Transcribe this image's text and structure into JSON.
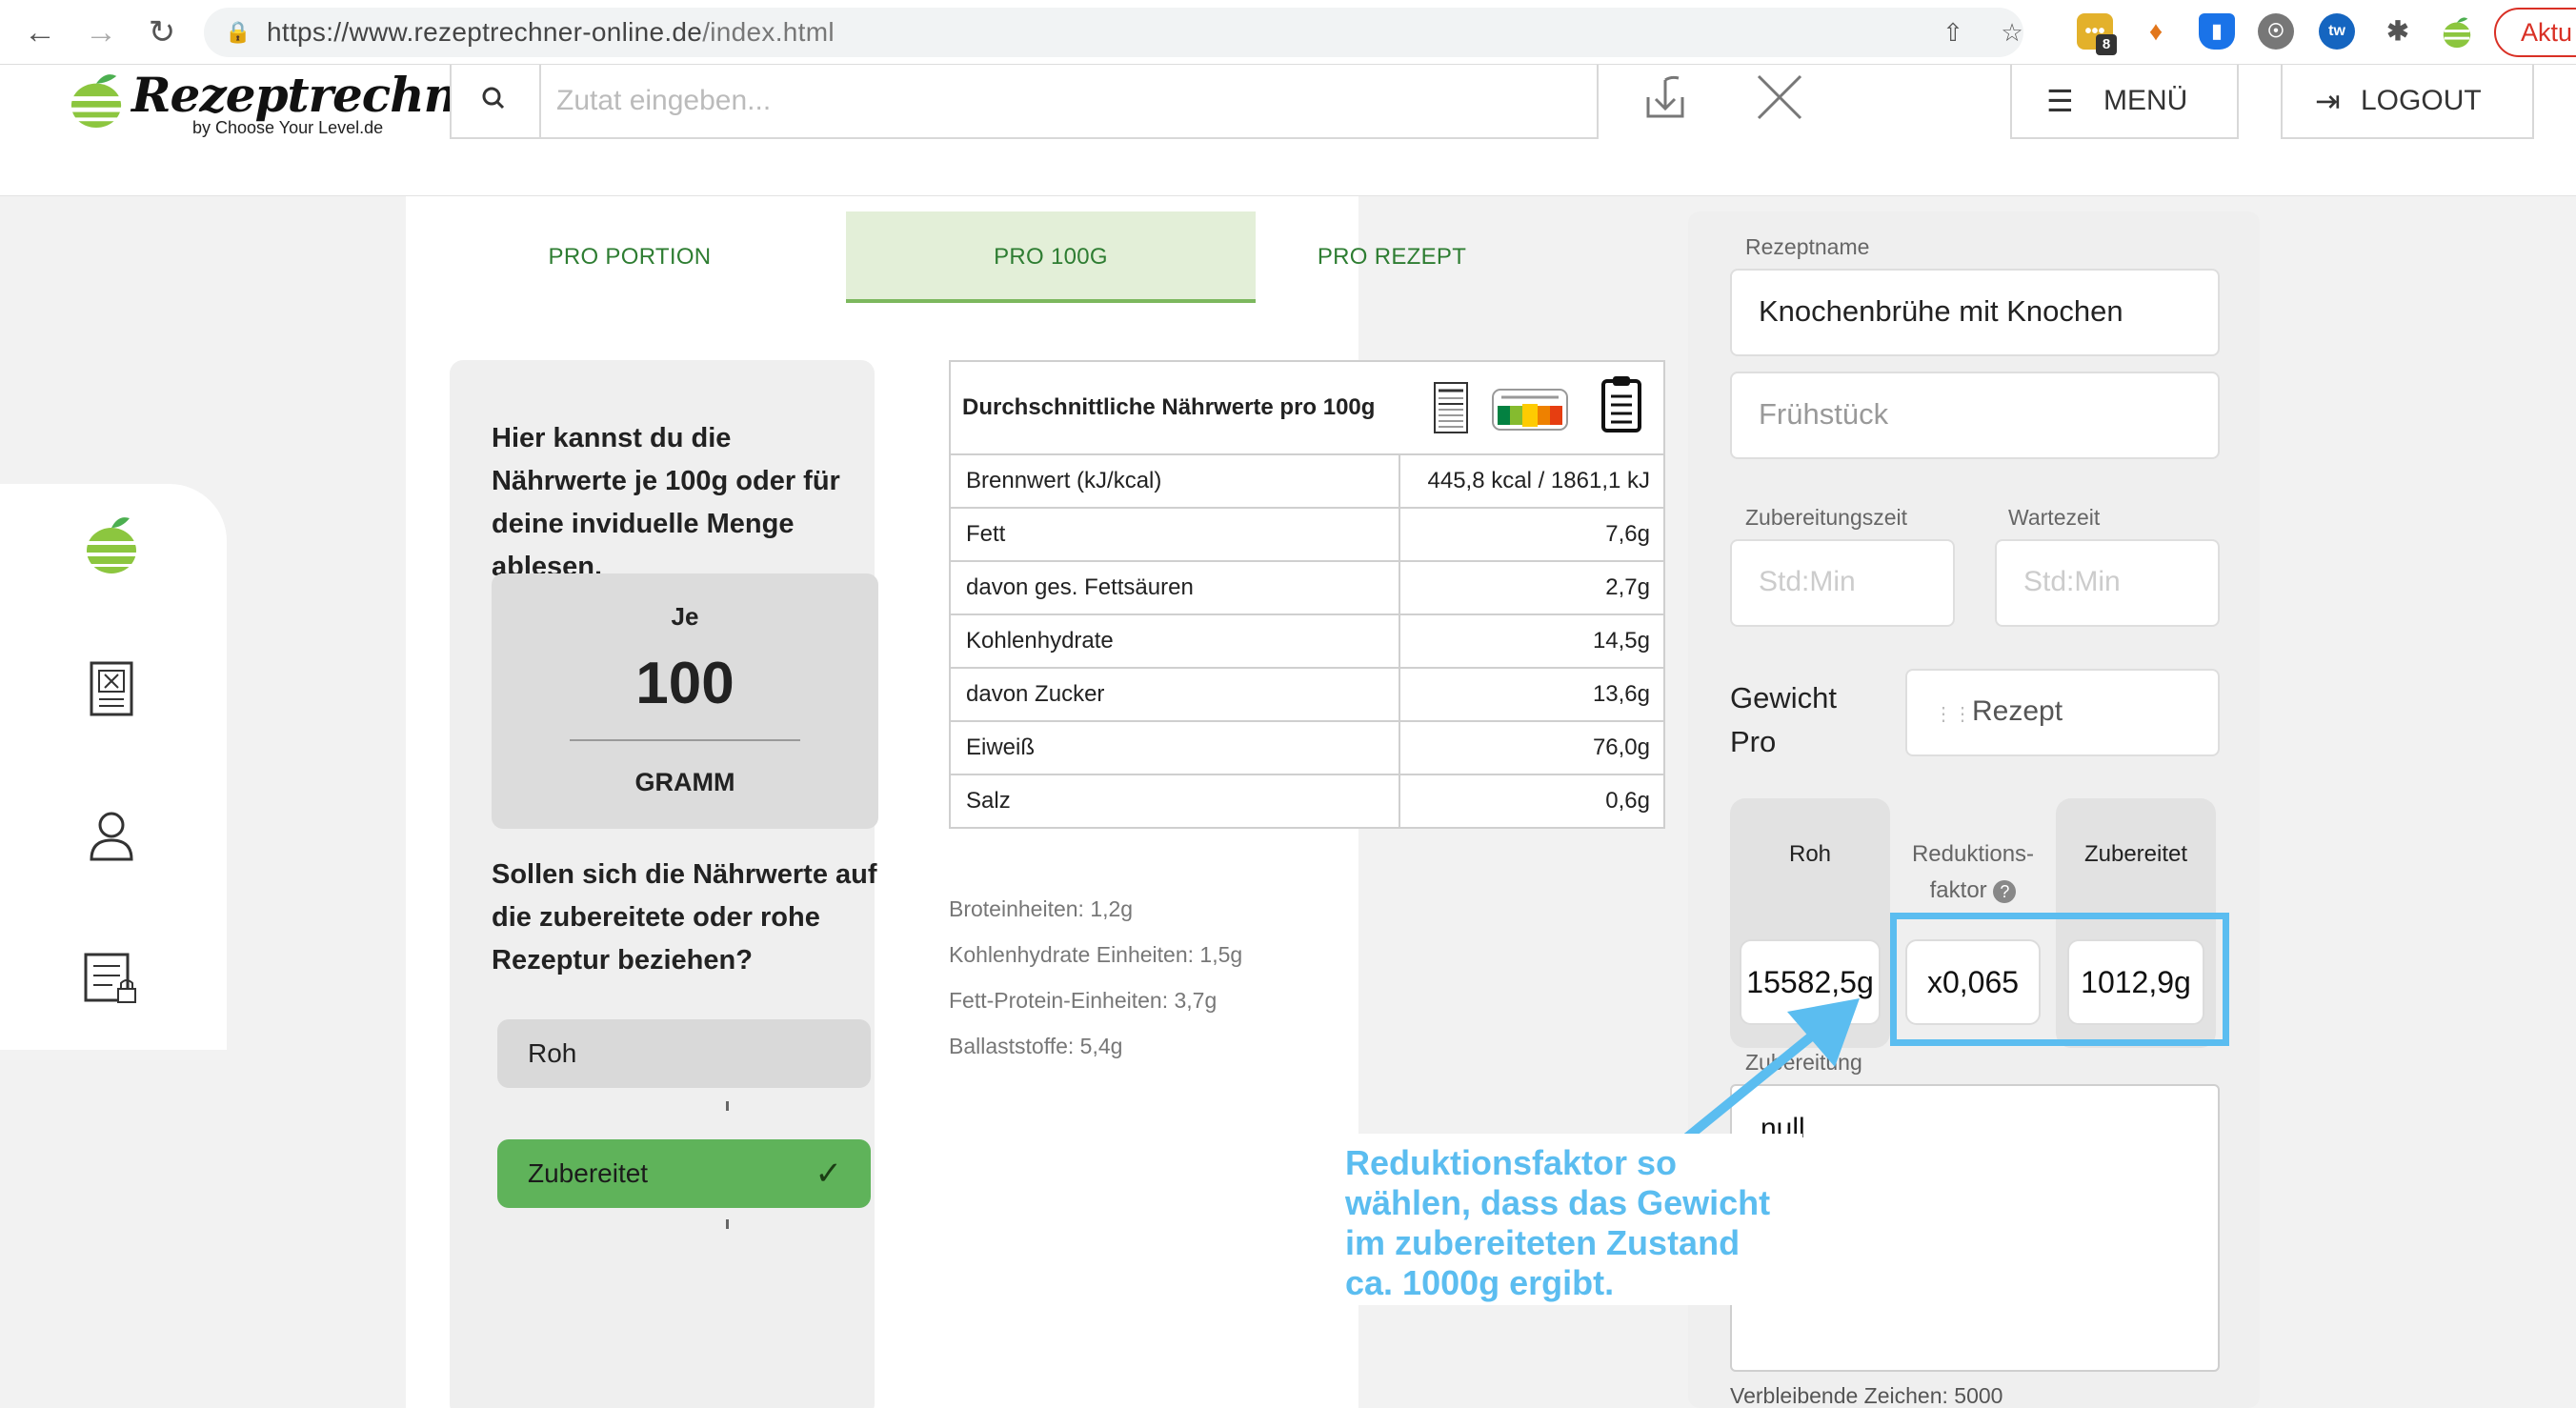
{
  "browser": {
    "url_prefix": "https://www.rezeptrechner-online.de",
    "url_path": "/index.html",
    "update_label": "Aktu",
    "extension_badge": "8"
  },
  "header": {
    "logo_text": "Rezeptrechner",
    "logo_sub": "by Choose Your Level.de",
    "search_placeholder": "Zutat eingeben...",
    "menu_label": "MENÜ",
    "logout_label": "LOGOUT"
  },
  "tabs": [
    {
      "label": "PRO PORTION",
      "active": false
    },
    {
      "label": "PRO 100G",
      "active": true
    },
    {
      "label": "PRO REZEPT",
      "active": false
    }
  ],
  "info": {
    "intro": "Hier kannst du die Nährwerte je 100g oder für deine inviduelle Menge ablesen.",
    "per_label": "Je",
    "amount": "100",
    "unit": "GRAMM",
    "question": "Sollen sich die Nährwerte auf die zubereitete oder rohe Rezeptur beziehen?",
    "option_raw": "Roh",
    "option_cooked": "Zubereitet"
  },
  "nutrition": {
    "title": "Durchschnittliche Nährwerte pro 100g",
    "rows": [
      {
        "label": "Brennwert (kJ/kcal)",
        "value": "445,8 kcal / 1861,1 kJ"
      },
      {
        "label": "Fett",
        "value": "7,6g"
      },
      {
        "label": "davon ges. Fettsäuren",
        "value": "2,7g"
      },
      {
        "label": "Kohlenhydrate",
        "value": "14,5g"
      },
      {
        "label": "davon Zucker",
        "value": "13,6g"
      },
      {
        "label": "Eiweiß",
        "value": "76,0g"
      },
      {
        "label": "Salz",
        "value": "0,6g"
      }
    ],
    "extra": [
      "Broteinheiten: 1,2g",
      "Kohlenhydrate Einheiten: 1,5g",
      "Fett-Protein-Einheiten: 3,7g",
      "Ballaststoffe: 5,4g"
    ]
  },
  "recipe": {
    "name_label": "Rezeptname",
    "name_value": "Knochenbrühe mit Knochen",
    "category_value": "Frühstück",
    "prep_label": "Zubereitungszeit",
    "prep_placeholder": "Std:Min",
    "wait_label": "Wartezeit",
    "wait_placeholder": "Std:Min",
    "weight_label_1": "Gewicht",
    "weight_label_2": "Pro",
    "weight_per_value": "Rezept",
    "raw_title": "Roh",
    "factor_title_1": "Reduktions-",
    "factor_title_2": "faktor",
    "cooked_title": "Zubereitet",
    "raw_value": "15582,5g",
    "factor_value": "x0,065",
    "cooked_value": "1012,9g",
    "prep_notes_label": "Zubereitung",
    "prep_notes_value": "null",
    "remaining_chars": "Verbleibende Zeichen: 5000"
  },
  "annotation": {
    "text": "Reduktionsfaktor so wählen, dass das Gewicht im zubereiteten Zustand ca. 1000g ergibt.",
    "color": "#5bbdf0"
  },
  "colors": {
    "accent_green": "#5fb35a",
    "tab_active_bg": "#e3efd8",
    "tab_text": "#2e7d32"
  }
}
